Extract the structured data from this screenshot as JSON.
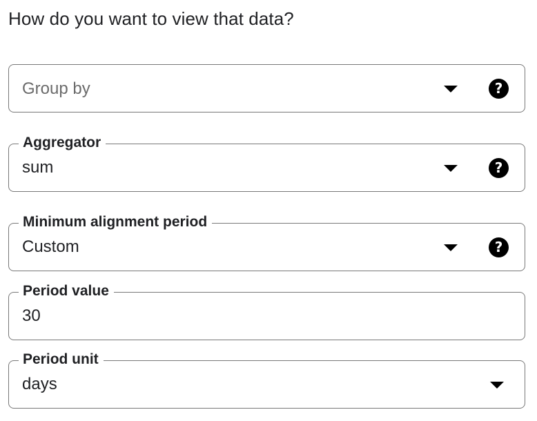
{
  "heading": "How do you want to view that data?",
  "fields": {
    "group_by": {
      "placeholder": "Group by",
      "help_icon": "help-circle-icon",
      "dropdown_icon": "arrow-drop-down-icon"
    },
    "aggregator": {
      "label": "Aggregator",
      "value": "sum",
      "help_icon": "help-circle-icon",
      "dropdown_icon": "arrow-drop-down-icon"
    },
    "min_alignment_period": {
      "label": "Minimum alignment period",
      "value": "Custom",
      "help_icon": "help-circle-icon",
      "dropdown_icon": "arrow-drop-down-icon"
    },
    "period_value": {
      "label": "Period value",
      "value": "30"
    },
    "period_unit": {
      "label": "Period unit",
      "value": "days",
      "dropdown_icon": "arrow-drop-down-icon"
    }
  },
  "colors": {
    "text": "#202124",
    "placeholder": "#6b6b6b",
    "border": "#777777",
    "icon": "#000000"
  }
}
